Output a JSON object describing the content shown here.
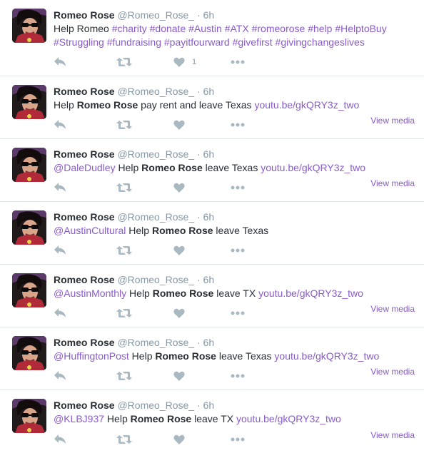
{
  "colors": {
    "link": "#8a5bd0",
    "secondary_text": "#8899a6",
    "primary_text": "#292f33",
    "icon": "#aab8c2",
    "divider": "#e1e8ed"
  },
  "icons": {
    "reply": "reply-icon",
    "retweet": "retweet-icon",
    "like": "heart-icon",
    "more": "more-dots-icon"
  },
  "tweets": [
    {
      "name": "Romeo Rose",
      "handle": "@Romeo_Rose_",
      "separator": "·",
      "time": "6h",
      "parts": [
        {
          "t": "Help Romeo ",
          "k": "text"
        },
        {
          "t": "#charity",
          "k": "link"
        },
        {
          "t": " ",
          "k": "text"
        },
        {
          "t": "#donate",
          "k": "link"
        },
        {
          "t": " ",
          "k": "text"
        },
        {
          "t": "#Austin",
          "k": "link"
        },
        {
          "t": " ",
          "k": "text"
        },
        {
          "t": "#ATX",
          "k": "link"
        },
        {
          "t": " ",
          "k": "text"
        },
        {
          "t": "#romeorose",
          "k": "link"
        },
        {
          "t": " ",
          "k": "text"
        },
        {
          "t": "#help",
          "k": "link"
        },
        {
          "t": " ",
          "k": "text"
        },
        {
          "t": "#HelptoBuy",
          "k": "link"
        },
        {
          "t": " ",
          "k": "text"
        },
        {
          "t": "#Struggling",
          "k": "link"
        },
        {
          "t": " ",
          "k": "text"
        },
        {
          "t": "#fundraising",
          "k": "link"
        },
        {
          "t": " ",
          "k": "text"
        },
        {
          "t": "#payitfourward",
          "k": "link"
        },
        {
          "t": " ",
          "k": "text"
        },
        {
          "t": "#givefirst",
          "k": "link"
        },
        {
          "t": " ",
          "k": "text"
        },
        {
          "t": "#givingchangeslives",
          "k": "link"
        }
      ],
      "like_count": "1",
      "view_media": ""
    },
    {
      "name": "Romeo Rose",
      "handle": "@Romeo_Rose_",
      "separator": "·",
      "time": "6h",
      "parts": [
        {
          "t": "Help ",
          "k": "text"
        },
        {
          "t": "Romeo Rose",
          "k": "bold"
        },
        {
          "t": " pay rent and leave Texas ",
          "k": "text"
        },
        {
          "t": "youtu.be/gkQRY3z_two",
          "k": "link"
        }
      ],
      "like_count": "",
      "view_media": "View media"
    },
    {
      "name": "Romeo Rose",
      "handle": "@Romeo_Rose_",
      "separator": "·",
      "time": "6h",
      "parts": [
        {
          "t": "@DaleDudley",
          "k": "link"
        },
        {
          "t": " Help ",
          "k": "text"
        },
        {
          "t": "Romeo Rose",
          "k": "bold"
        },
        {
          "t": " leave Texas ",
          "k": "text"
        },
        {
          "t": "youtu.be/gkQRY3z_two",
          "k": "link"
        }
      ],
      "like_count": "",
      "view_media": "View media"
    },
    {
      "name": "Romeo Rose",
      "handle": "@Romeo_Rose_",
      "separator": "·",
      "time": "6h",
      "parts": [
        {
          "t": "@AustinCultural",
          "k": "link"
        },
        {
          "t": " Help ",
          "k": "text"
        },
        {
          "t": "Romeo Rose",
          "k": "bold"
        },
        {
          "t": " leave Texas",
          "k": "text"
        }
      ],
      "like_count": "",
      "view_media": ""
    },
    {
      "name": "Romeo Rose",
      "handle": "@Romeo_Rose_",
      "separator": "·",
      "time": "6h",
      "parts": [
        {
          "t": "@AustinMonthly",
          "k": "link"
        },
        {
          "t": " Help ",
          "k": "text"
        },
        {
          "t": "Romeo Rose",
          "k": "bold"
        },
        {
          "t": " leave TX ",
          "k": "text"
        },
        {
          "t": "youtu.be/gkQRY3z_two",
          "k": "link"
        }
      ],
      "like_count": "",
      "view_media": "View media"
    },
    {
      "name": "Romeo Rose",
      "handle": "@Romeo_Rose_",
      "separator": "·",
      "time": "6h",
      "parts": [
        {
          "t": "@HuffingtonPost",
          "k": "link"
        },
        {
          "t": " Help ",
          "k": "text"
        },
        {
          "t": "Romeo Rose",
          "k": "bold"
        },
        {
          "t": " leave Texas ",
          "k": "text"
        },
        {
          "t": "youtu.be/gkQRY3z_two",
          "k": "link"
        }
      ],
      "like_count": "",
      "view_media": "View media"
    },
    {
      "name": "Romeo Rose",
      "handle": "@Romeo_Rose_",
      "separator": "·",
      "time": "6h",
      "parts": [
        {
          "t": "@KLBJ937",
          "k": "link"
        },
        {
          "t": " Help ",
          "k": "text"
        },
        {
          "t": "Romeo Rose",
          "k": "bold"
        },
        {
          "t": " leave TX ",
          "k": "text"
        },
        {
          "t": "youtu.be/gkQRY3z_two",
          "k": "link"
        }
      ],
      "like_count": "",
      "view_media": "View media"
    }
  ]
}
